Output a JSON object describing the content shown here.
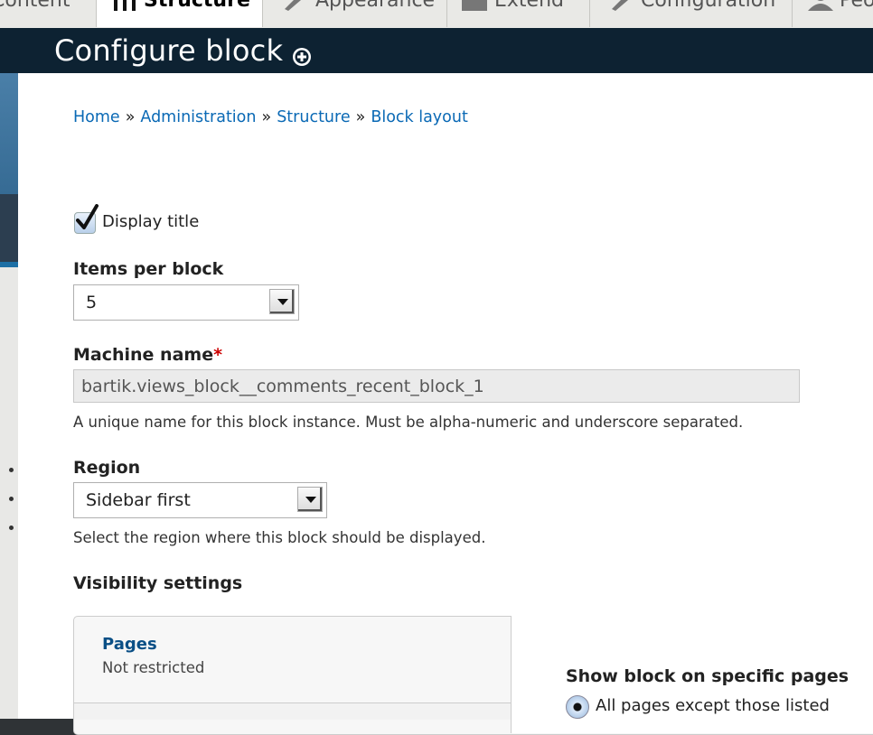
{
  "toolbar": {
    "items": [
      {
        "label": "Content",
        "icon": "content-icon"
      },
      {
        "label": "Structure",
        "icon": "structure-icon",
        "active": true
      },
      {
        "label": "Appearance",
        "icon": "appearance-icon"
      },
      {
        "label": "Extend",
        "icon": "extend-icon"
      },
      {
        "label": "Configuration",
        "icon": "configuration-icon"
      },
      {
        "label": "Peo",
        "icon": "people-icon"
      }
    ]
  },
  "page": {
    "title": "Configure block"
  },
  "breadcrumb": {
    "items": [
      "Home",
      "Administration",
      "Structure",
      "Block layout"
    ],
    "separator": "»"
  },
  "form": {
    "display_title": {
      "label": "Display title",
      "checked": true
    },
    "items_per_block": {
      "label": "Items per block",
      "value": "5"
    },
    "machine_name": {
      "label": "Machine name",
      "required_mark": "*",
      "value": "bartik.views_block__comments_recent_block_1",
      "description": "A unique name for this block instance. Must be alpha-numeric and underscore separated."
    },
    "region": {
      "label": "Region",
      "value": "Sidebar first",
      "description": "Select the region where this block should be displayed."
    },
    "visibility": {
      "heading": "Visibility settings",
      "tab_title": "Pages",
      "tab_summary": "Not restricted",
      "pane_heading": "Show block on specific pages",
      "radio_option": "All pages except those listed"
    }
  },
  "colors": {
    "title_bar": "#0d2232",
    "link": "#0a69b5",
    "required": "#cc0000"
  }
}
